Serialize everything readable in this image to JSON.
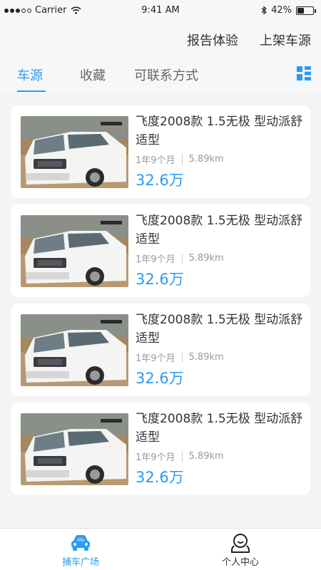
{
  "status_bar": {
    "carrier": "Carrier",
    "time": "9:41 AM",
    "battery": "42%",
    "battery_level": 0.42
  },
  "header": {
    "report_label": "报告体验",
    "list_label": "上架车源"
  },
  "tabs": [
    {
      "label": "车源",
      "active": true
    },
    {
      "label": "收藏",
      "active": false
    },
    {
      "label": "可联系方式",
      "active": false
    }
  ],
  "listings": [
    {
      "title": "飞度2008款 1.5无极 型动派舒适型",
      "age": "1年9个月",
      "mileage": "5.89km",
      "price": "32.6万"
    },
    {
      "title": "飞度2008款 1.5无极 型动派舒适型",
      "age": "1年9个月",
      "mileage": "5.89km",
      "price": "32.6万"
    },
    {
      "title": "飞度2008款 1.5无极 型动派舒适型",
      "age": "1年9个月",
      "mileage": "5.89km",
      "price": "32.6万"
    },
    {
      "title": "飞度2008款 1.5无极 型动派舒适型",
      "age": "1年9个月",
      "mileage": "5.89km",
      "price": "32.6万"
    }
  ],
  "bottom_nav": [
    {
      "label": "捕车广场",
      "icon": "car-icon",
      "active": true
    },
    {
      "label": "个人中心",
      "icon": "person-icon",
      "active": false
    }
  ],
  "colors": {
    "accent": "#2a9bf0",
    "background": "#f4f4f4",
    "card": "#ffffff"
  }
}
